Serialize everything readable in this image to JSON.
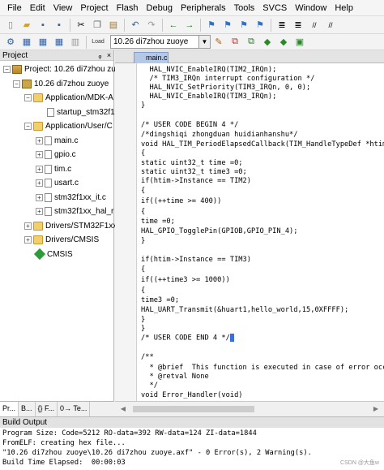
{
  "menu": [
    "File",
    "Edit",
    "View",
    "Project",
    "Flash",
    "Debug",
    "Peripherals",
    "Tools",
    "SVCS",
    "Window",
    "Help"
  ],
  "toolbar": {
    "target_name": "10.26 di7zhou zuoye",
    "load_label": "Load"
  },
  "project_panel": {
    "title": "Project",
    "pin": "ᵩ",
    "close": "×",
    "tree": [
      {
        "label": "Project: 10.26 di7zhou zuoye",
        "expander": "−",
        "icon": "proj"
      },
      {
        "label": "10.26 di7zhou zuoye",
        "expander": "−",
        "icon": "target"
      },
      {
        "label": "Application/MDK-A",
        "expander": "−",
        "icon": "folder"
      },
      {
        "label": "startup_stm32f1",
        "expander": "",
        "icon": "file"
      },
      {
        "label": "Application/User/C",
        "expander": "−",
        "icon": "folder"
      },
      {
        "label": "main.c",
        "expander": "+",
        "icon": "file"
      },
      {
        "label": "gpio.c",
        "expander": "+",
        "icon": "file"
      },
      {
        "label": "tim.c",
        "expander": "+",
        "icon": "file"
      },
      {
        "label": "usart.c",
        "expander": "+",
        "icon": "file"
      },
      {
        "label": "stm32f1xx_it.c",
        "expander": "+",
        "icon": "file"
      },
      {
        "label": "stm32f1xx_hal_r",
        "expander": "+",
        "icon": "file"
      },
      {
        "label": "Drivers/STM32F1xx_",
        "expander": "+",
        "icon": "folder"
      },
      {
        "label": "Drivers/CMSIS",
        "expander": "+",
        "icon": "folder"
      },
      {
        "label": "CMSIS",
        "expander": "",
        "icon": "gem"
      }
    ],
    "tabs": [
      "Pr...",
      "B...",
      "{} F...",
      "0→ Te..."
    ]
  },
  "editor": {
    "tab": "main.c",
    "lines": [
      "  HAL_NVIC_EnableIRQ(TIM2_IRQn);",
      "  /* TIM3_IRQn interrupt configuration */",
      "  HAL_NVIC_SetPriority(TIM3_IRQn, 0, 0);",
      "  HAL_NVIC_EnableIRQ(TIM3_IRQn);",
      "}",
      "",
      "/* USER CODE BEGIN 4 */",
      "/*dingshiqi zhongduan huidianhanshu*/",
      "void HAL_TIM_PeriodElapsedCallback(TIM_HandleTypeDef *htim)",
      "{",
      "static uint32_t time =0;",
      "static uint32_t time3 =0;",
      "if(htim->Instance == TIM2)",
      "{",
      "if((++time >= 400))",
      "{",
      "time =0;",
      "HAL_GPIO_TogglePin(GPIOB,GPIO_PIN_4);",
      "}",
      "",
      "if(htim->Instance == TIM3)",
      "{",
      "if((++time3 >= 1000))",
      "{",
      "time3 =0;",
      "HAL_UART_Transmit(&huart1,hello_world,15,0XFFFF);",
      "}",
      "}",
      "/* USER CODE END 4 */",
      "",
      "/**",
      "  * @brief  This function is executed in case of error occurrence.",
      "  * @retval None",
      "  */",
      "void Error_Handler(void)"
    ]
  },
  "build": {
    "title": "Build Output",
    "lines": [
      "Program Size: Code=5212 RO-data=392 RW-data=124 ZI-data=1844",
      "FromELF: creating hex file...",
      "\"10.26 di7zhou zuoye\\10.26 di7zhou zuoye.axf\" - 0 Error(s), 2 Warning(s).",
      "Build Time Elapsed:  00:00:03"
    ]
  },
  "watermark": "CSDN @大鱼w"
}
